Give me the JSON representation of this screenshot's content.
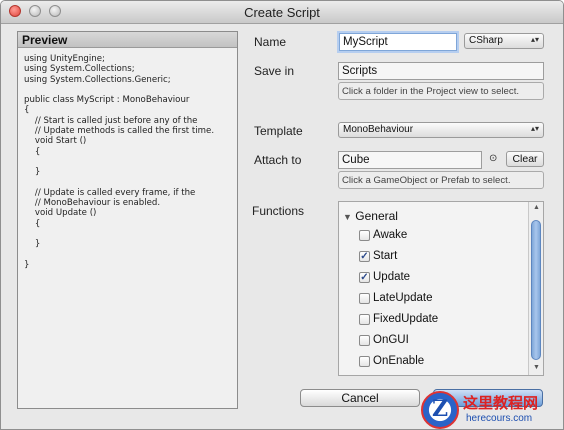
{
  "window": {
    "title": "Create Script"
  },
  "preview": {
    "header": "Preview",
    "code": "using UnityEngine;\nusing System.Collections;\nusing System.Collections.Generic;\n\npublic class MyScript : MonoBehaviour\n{\n    // Start is called just before any of the\n    // Update methods is called the first time.\n    void Start ()\n    {\n\n    }\n\n    // Update is called every frame, if the\n    // MonoBehaviour is enabled.\n    void Update ()\n    {\n\n    }\n\n}"
  },
  "form": {
    "name_label": "Name",
    "name_value": "MyScript",
    "language_value": "CSharp",
    "save_in_label": "Save in",
    "save_in_value": "Scripts",
    "save_in_hint": "Click a folder in the Project view to select.",
    "template_label": "Template",
    "template_value": "MonoBehaviour",
    "attach_to_label": "Attach to",
    "attach_to_value": "Cube",
    "clear_label": "Clear",
    "attach_to_hint": "Click a GameObject or Prefab to select.",
    "functions_label": "Functions"
  },
  "functions": {
    "group": "General",
    "items": [
      {
        "label": "Awake",
        "checked": false
      },
      {
        "label": "Start",
        "checked": true
      },
      {
        "label": "Update",
        "checked": true
      },
      {
        "label": "LateUpdate",
        "checked": false
      },
      {
        "label": "FixedUpdate",
        "checked": false
      },
      {
        "label": "OnGUI",
        "checked": false
      },
      {
        "label": "OnEnable",
        "checked": false
      }
    ]
  },
  "buttons": {
    "cancel": "Cancel"
  },
  "watermark": {
    "logo": "Z",
    "name": "这里教程网",
    "url": "herecours.com"
  },
  "colors": {
    "accent": "#7fa6d8",
    "watermark_red": "#dd2222",
    "watermark_blue": "#1d4fb0"
  }
}
